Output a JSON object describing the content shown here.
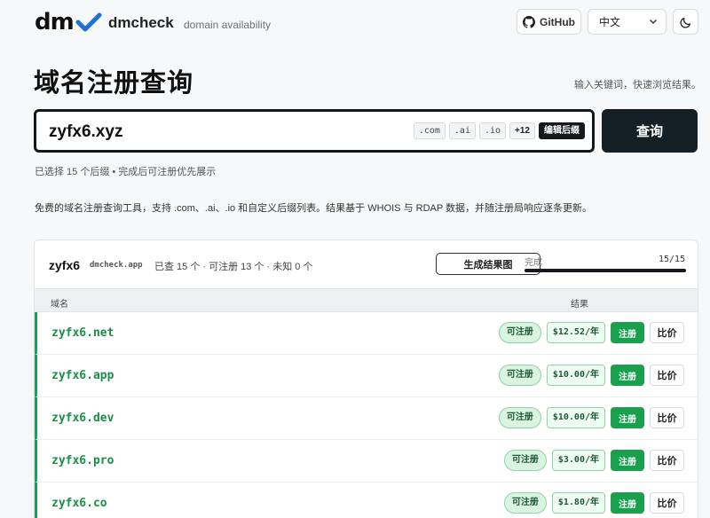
{
  "header": {
    "logo_text": "dm",
    "brand": "dmcheck",
    "tagline": "domain availability",
    "github_label": "GitHub",
    "language": "中文"
  },
  "title": "域名注册查询",
  "hint": "输入关键词，快速浏览结果。",
  "search": {
    "value": "zyfx6.xyz",
    "chips": [
      ".com",
      ".ai",
      ".io"
    ],
    "more": "+12",
    "edit_label": "编辑后缀",
    "query_label": "查询"
  },
  "meta_line": "已选择 15 个后缀 • 完成后可注册优先展示",
  "description": "免费的域名注册查询工具，支持 .com、.ai、.io 和自定义后缀列表。结果基于 WHOIS 与 RDAP 数据，并随注册局响应逐条更新。",
  "results": {
    "name": "zyfx6",
    "host": "dmcheck.app",
    "stats": "已查 15 个 · 可注册 13 个 · 未知 0 个",
    "report_label": "生成结果图",
    "progress_label": "完成",
    "progress_count": "15/15",
    "progress": 1.0,
    "col_domain": "域名",
    "col_result": "结果",
    "rows": [
      {
        "domain": "zyfx6.net",
        "status": "可注册",
        "price": "$12.52/年",
        "register": "注册",
        "compare": "比价"
      },
      {
        "domain": "zyfx6.app",
        "status": "可注册",
        "price": "$10.00/年",
        "register": "注册",
        "compare": "比价"
      },
      {
        "domain": "zyfx6.dev",
        "status": "可注册",
        "price": "$10.00/年",
        "register": "注册",
        "compare": "比价"
      },
      {
        "domain": "zyfx6.pro",
        "status": "可注册",
        "price": "$3.00/年",
        "register": "注册",
        "compare": "比价"
      },
      {
        "domain": "zyfx6.co",
        "status": "可注册",
        "price": "$1.80/年",
        "register": "注册",
        "compare": "比价"
      }
    ]
  },
  "colors": {
    "accent_green": "#19a04f",
    "dark": "#142026"
  },
  "icons": {
    "logo": "checkmark-icon",
    "github": "github-icon",
    "theme": "moon-icon",
    "select": "chevron-down-icon"
  }
}
